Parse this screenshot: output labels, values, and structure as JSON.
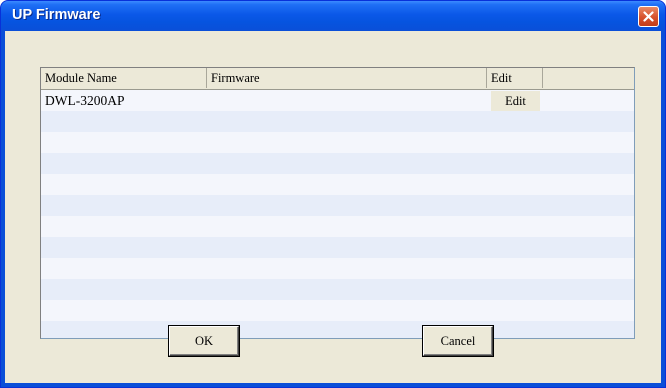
{
  "window": {
    "title": "UP Firmware"
  },
  "table": {
    "columns": [
      "Module Name",
      "Firmware",
      "Edit",
      ""
    ],
    "rows": [
      {
        "module_name": "DWL-3200AP",
        "firmware": "",
        "edit_label": "Edit"
      }
    ],
    "empty_row_count": 9
  },
  "buttons": {
    "ok": "OK",
    "cancel": "Cancel"
  },
  "colors": {
    "titlebar": "#0a4fd8",
    "dialog_bg": "#ece9d8",
    "close_button": "#d7512c",
    "row_even": "#f4f6fc",
    "row_odd": "#e7edf9"
  },
  "icons": {
    "close": "close-x-icon"
  }
}
